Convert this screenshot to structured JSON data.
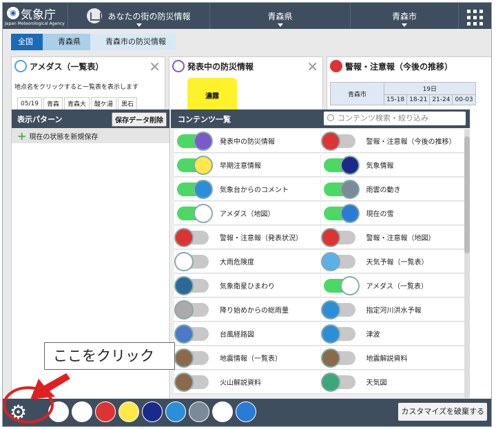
{
  "header": {
    "logo_jp": "気象庁",
    "logo_en": "Japan Meteorological Agency",
    "home_tab": "あなたの街の防災情報",
    "pref_tab": "青森県",
    "city_tab": "青森市"
  },
  "breadcrumb": [
    "全国",
    "青森県",
    "青森市の防災情報"
  ],
  "panels": {
    "amedas": {
      "title": "アメダス（一覧表）",
      "hint": "地点名をクリックすると一覧表を表示します",
      "date": "05/19",
      "cols": [
        "青森",
        "青森大",
        "酸ケ湯",
        "黒石"
      ]
    },
    "bousai": {
      "title": "発表中の防災情報",
      "badge": "濃霧"
    },
    "warning": {
      "title": "警報・注意報（今後の推移）",
      "city": "青森市",
      "day": "19日",
      "times": [
        "15-18",
        "18-21",
        "21-24",
        "00-03"
      ]
    }
  },
  "pattern": {
    "header": "表示パターン",
    "delete_button": "保存データ削除",
    "new_save": "現在の状態を新規保存"
  },
  "contents": {
    "header": "コンテンツ一覧",
    "search_placeholder": "コンテンツ検索・絞り込み",
    "items": [
      {
        "label": "発表中の防災情報",
        "on": true
      },
      {
        "label": "警報・注意報（今後の推移）",
        "on": false
      },
      {
        "label": "早期注意情報",
        "on": true
      },
      {
        "label": "気象情報",
        "on": true
      },
      {
        "label": "気象台からのコメント",
        "on": true
      },
      {
        "label": "雨雲の動き",
        "on": true
      },
      {
        "label": "アメダス（地図）",
        "on": true
      },
      {
        "label": "現在の雪",
        "on": true
      },
      {
        "label": "警報・注意報（発表状況）",
        "on": false
      },
      {
        "label": "警報・注意報（地図）",
        "on": false
      },
      {
        "label": "大雨危険度",
        "on": false
      },
      {
        "label": "天気予報（一覧表）",
        "on": false
      },
      {
        "label": "気象衛星ひまわり",
        "on": false
      },
      {
        "label": "アメダス（一覧表）",
        "on": true
      },
      {
        "label": "降り始めからの総雨量",
        "on": false
      },
      {
        "label": "指定河川洪水予報",
        "on": false
      },
      {
        "label": "台風経路図",
        "on": false
      },
      {
        "label": "津波",
        "on": false
      },
      {
        "label": "地震情報（一覧表）",
        "on": false
      },
      {
        "label": "地震解説資料",
        "on": false
      },
      {
        "label": "火山解説資料",
        "on": false
      },
      {
        "label": "天気図",
        "on": false
      }
    ]
  },
  "bottom": {
    "destroy_button": "カスタマイズを破棄する"
  },
  "callout": "ここをクリック",
  "colors": {
    "header": "#3f4e5e",
    "toggle_on": "#4cd864",
    "accent_red": "#e02020"
  }
}
